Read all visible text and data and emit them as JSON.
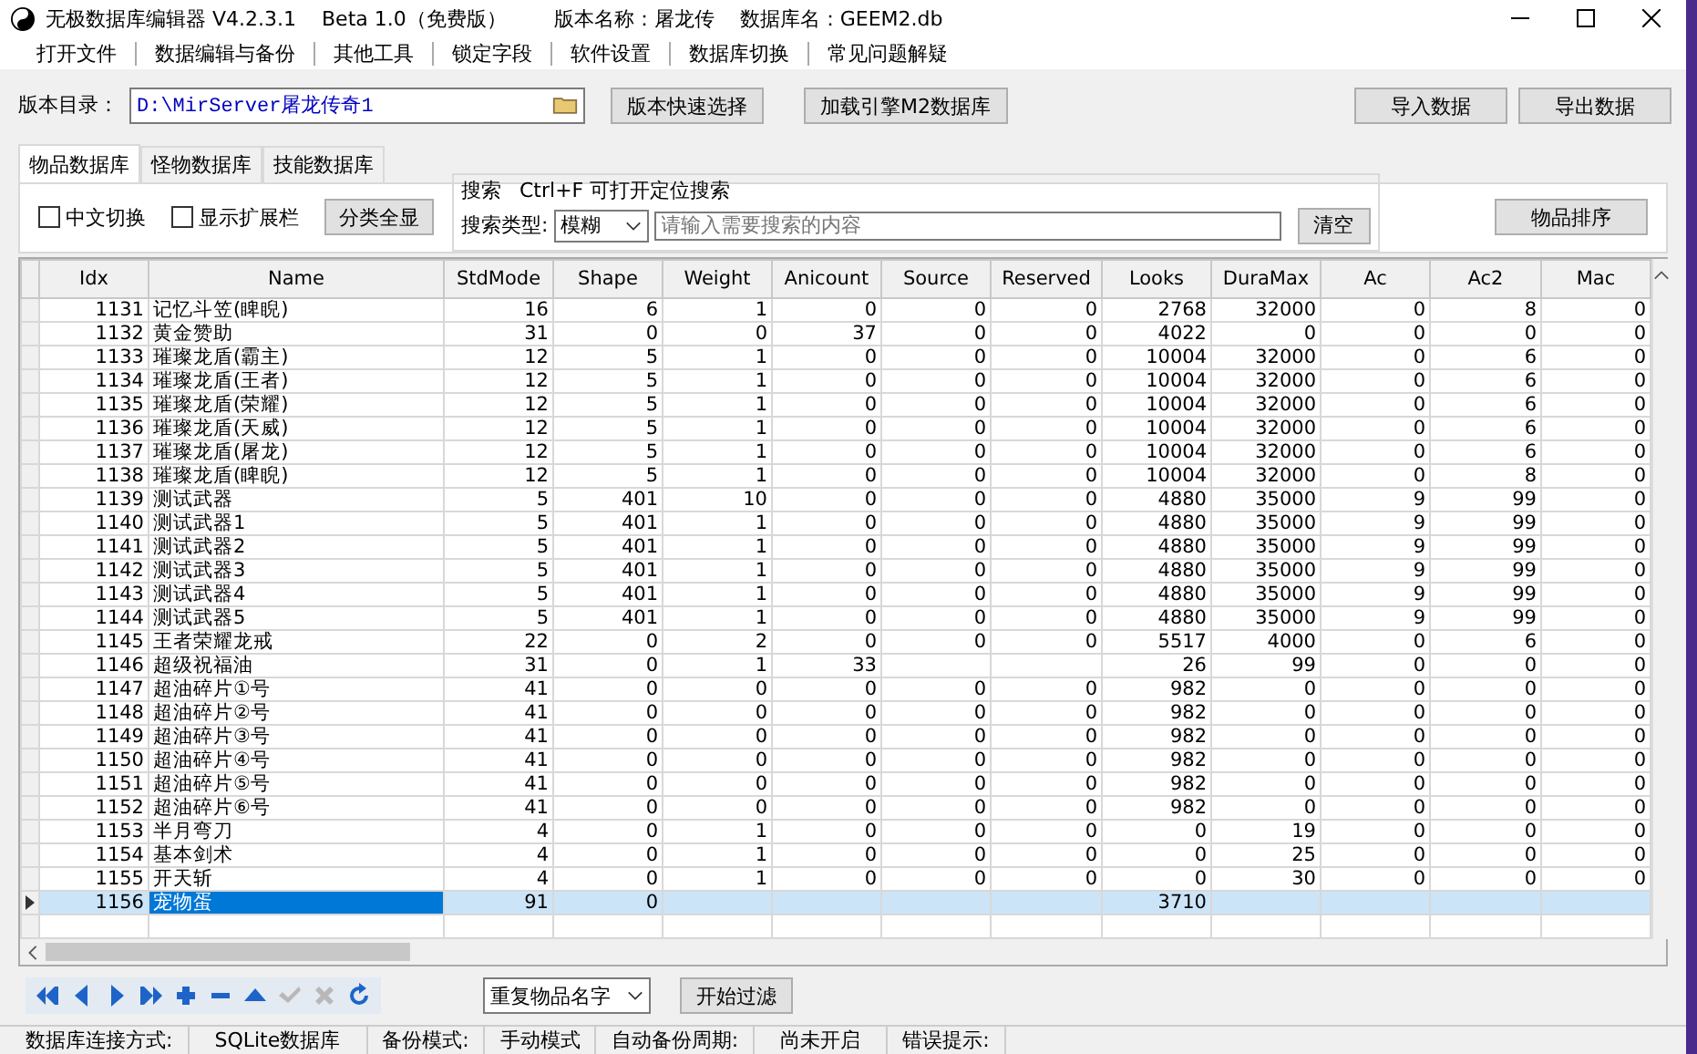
{
  "window": {
    "title": "无极数据库编辑器 V4.2.3.1",
    "edition": "Beta 1.0（免费版）",
    "version_name": "版本名称：屠龙传",
    "database_name": "数据库名：GEEM2.db"
  },
  "menu": [
    "打开文件",
    "数据编辑与备份",
    "其他工具",
    "锁定字段",
    "软件设置",
    "数据库切换",
    "常见问题解疑"
  ],
  "path_bar": {
    "label": "版本目录：",
    "value": "D:\\MirServer屠龙传奇1",
    "buttons": [
      "版本快速选择",
      "加载引擎M2数据库"
    ],
    "right_buttons": [
      "导入数据",
      "导出数据"
    ]
  },
  "tabs": [
    {
      "label": "物品数据库",
      "selected": true
    },
    {
      "label": "怪物数据库",
      "selected": false
    },
    {
      "label": "技能数据库",
      "selected": false
    }
  ],
  "options": [
    {
      "label": "中文切换",
      "checked": false
    },
    {
      "label": "显示扩展栏",
      "checked": false
    }
  ],
  "show_all_button": "分类全显",
  "search": {
    "title": "搜索",
    "hint": "Ctrl+F 可打开定位搜索",
    "type_label": "搜索类型:",
    "type_value": "模糊",
    "placeholder": "请输入需要搜索的内容",
    "clear_button": "清空"
  },
  "sort_button": "物品排序",
  "table": {
    "columns": [
      "Idx",
      "Name",
      "StdMode",
      "Shape",
      "Weight",
      "Anicount",
      "Source",
      "Reserved",
      "Looks",
      "DuraMax",
      "Ac",
      "Ac2",
      "Mac"
    ],
    "rows": [
      {
        "selected": false,
        "cells": [
          "1131",
          "记忆斗笠(睥睨)",
          "16",
          "6",
          "1",
          "0",
          "0",
          "0",
          "2768",
          "32000",
          "0",
          "8",
          "0"
        ]
      },
      {
        "selected": false,
        "cells": [
          "1132",
          "黄金赞助",
          "31",
          "0",
          "0",
          "37",
          "0",
          "0",
          "4022",
          "0",
          "0",
          "0",
          "0"
        ]
      },
      {
        "selected": false,
        "cells": [
          "1133",
          "璀璨龙盾(霸主)",
          "12",
          "5",
          "1",
          "0",
          "0",
          "0",
          "10004",
          "32000",
          "0",
          "6",
          "0"
        ]
      },
      {
        "selected": false,
        "cells": [
          "1134",
          "璀璨龙盾(王者)",
          "12",
          "5",
          "1",
          "0",
          "0",
          "0",
          "10004",
          "32000",
          "0",
          "6",
          "0"
        ]
      },
      {
        "selected": false,
        "cells": [
          "1135",
          "璀璨龙盾(荣耀)",
          "12",
          "5",
          "1",
          "0",
          "0",
          "0",
          "10004",
          "32000",
          "0",
          "6",
          "0"
        ]
      },
      {
        "selected": false,
        "cells": [
          "1136",
          "璀璨龙盾(天威)",
          "12",
          "5",
          "1",
          "0",
          "0",
          "0",
          "10004",
          "32000",
          "0",
          "6",
          "0"
        ]
      },
      {
        "selected": false,
        "cells": [
          "1137",
          "璀璨龙盾(屠龙)",
          "12",
          "5",
          "1",
          "0",
          "0",
          "0",
          "10004",
          "32000",
          "0",
          "6",
          "0"
        ]
      },
      {
        "selected": false,
        "cells": [
          "1138",
          "璀璨龙盾(睥睨)",
          "12",
          "5",
          "1",
          "0",
          "0",
          "0",
          "10004",
          "32000",
          "0",
          "8",
          "0"
        ]
      },
      {
        "selected": false,
        "cells": [
          "1139",
          "测试武器",
          "5",
          "401",
          "10",
          "0",
          "0",
          "0",
          "4880",
          "35000",
          "9",
          "99",
          "0"
        ]
      },
      {
        "selected": false,
        "cells": [
          "1140",
          "测试武器1",
          "5",
          "401",
          "1",
          "0",
          "0",
          "0",
          "4880",
          "35000",
          "9",
          "99",
          "0"
        ]
      },
      {
        "selected": false,
        "cells": [
          "1141",
          "测试武器2",
          "5",
          "401",
          "1",
          "0",
          "0",
          "0",
          "4880",
          "35000",
          "9",
          "99",
          "0"
        ]
      },
      {
        "selected": false,
        "cells": [
          "1142",
          "测试武器3",
          "5",
          "401",
          "1",
          "0",
          "0",
          "0",
          "4880",
          "35000",
          "9",
          "99",
          "0"
        ]
      },
      {
        "selected": false,
        "cells": [
          "1143",
          "测试武器4",
          "5",
          "401",
          "1",
          "0",
          "0",
          "0",
          "4880",
          "35000",
          "9",
          "99",
          "0"
        ]
      },
      {
        "selected": false,
        "cells": [
          "1144",
          "测试武器5",
          "5",
          "401",
          "1",
          "0",
          "0",
          "0",
          "4880",
          "35000",
          "9",
          "99",
          "0"
        ]
      },
      {
        "selected": false,
        "cells": [
          "1145",
          "王者荣耀龙戒",
          "22",
          "0",
          "2",
          "0",
          "0",
          "0",
          "5517",
          "4000",
          "0",
          "6",
          "0"
        ]
      },
      {
        "selected": false,
        "cells": [
          "1146",
          "超级祝福油",
          "31",
          "0",
          "1",
          "33",
          "",
          "",
          "26",
          "99",
          "0",
          "0",
          "0"
        ]
      },
      {
        "selected": false,
        "cells": [
          "1147",
          "超油碎片①号",
          "41",
          "0",
          "0",
          "0",
          "0",
          "0",
          "982",
          "0",
          "0",
          "0",
          "0"
        ]
      },
      {
        "selected": false,
        "cells": [
          "1148",
          "超油碎片②号",
          "41",
          "0",
          "0",
          "0",
          "0",
          "0",
          "982",
          "0",
          "0",
          "0",
          "0"
        ]
      },
      {
        "selected": false,
        "cells": [
          "1149",
          "超油碎片③号",
          "41",
          "0",
          "0",
          "0",
          "0",
          "0",
          "982",
          "0",
          "0",
          "0",
          "0"
        ]
      },
      {
        "selected": false,
        "cells": [
          "1150",
          "超油碎片④号",
          "41",
          "0",
          "0",
          "0",
          "0",
          "0",
          "982",
          "0",
          "0",
          "0",
          "0"
        ]
      },
      {
        "selected": false,
        "cells": [
          "1151",
          "超油碎片⑤号",
          "41",
          "0",
          "0",
          "0",
          "0",
          "0",
          "982",
          "0",
          "0",
          "0",
          "0"
        ]
      },
      {
        "selected": false,
        "cells": [
          "1152",
          "超油碎片⑥号",
          "41",
          "0",
          "0",
          "0",
          "0",
          "0",
          "982",
          "0",
          "0",
          "0",
          "0"
        ]
      },
      {
        "selected": false,
        "cells": [
          "1153",
          "半月弯刀",
          "4",
          "0",
          "1",
          "0",
          "0",
          "0",
          "0",
          "19",
          "0",
          "0",
          "0"
        ]
      },
      {
        "selected": false,
        "cells": [
          "1154",
          "基本剑术",
          "4",
          "0",
          "1",
          "0",
          "0",
          "0",
          "0",
          "25",
          "0",
          "0",
          "0"
        ]
      },
      {
        "selected": false,
        "cells": [
          "1155",
          "开天斩",
          "4",
          "0",
          "1",
          "0",
          "0",
          "0",
          "0",
          "30",
          "0",
          "0",
          "0"
        ]
      },
      {
        "selected": true,
        "cells": [
          "1156",
          "宠物蛋",
          "91",
          "0",
          "",
          "",
          "",
          "",
          "3710",
          "",
          "",
          "",
          ""
        ]
      }
    ]
  },
  "navigator": [
    {
      "kind": "first",
      "disabled": false
    },
    {
      "kind": "prev",
      "disabled": false
    },
    {
      "kind": "next",
      "disabled": false
    },
    {
      "kind": "last",
      "disabled": false
    },
    {
      "kind": "add",
      "disabled": false
    },
    {
      "kind": "delete",
      "disabled": false
    },
    {
      "kind": "edit",
      "disabled": false
    },
    {
      "kind": "post",
      "disabled": true
    },
    {
      "kind": "cancel",
      "disabled": true
    },
    {
      "kind": "refresh",
      "disabled": false
    }
  ],
  "filter": {
    "value": "重复物品名字",
    "button": "开始过滤"
  },
  "status_bar": [
    "数据库连接方式:",
    "SQLite数据库",
    "备份模式:",
    "手动模式",
    "自动备份周期:",
    "尚未开启",
    "错误提示:"
  ]
}
